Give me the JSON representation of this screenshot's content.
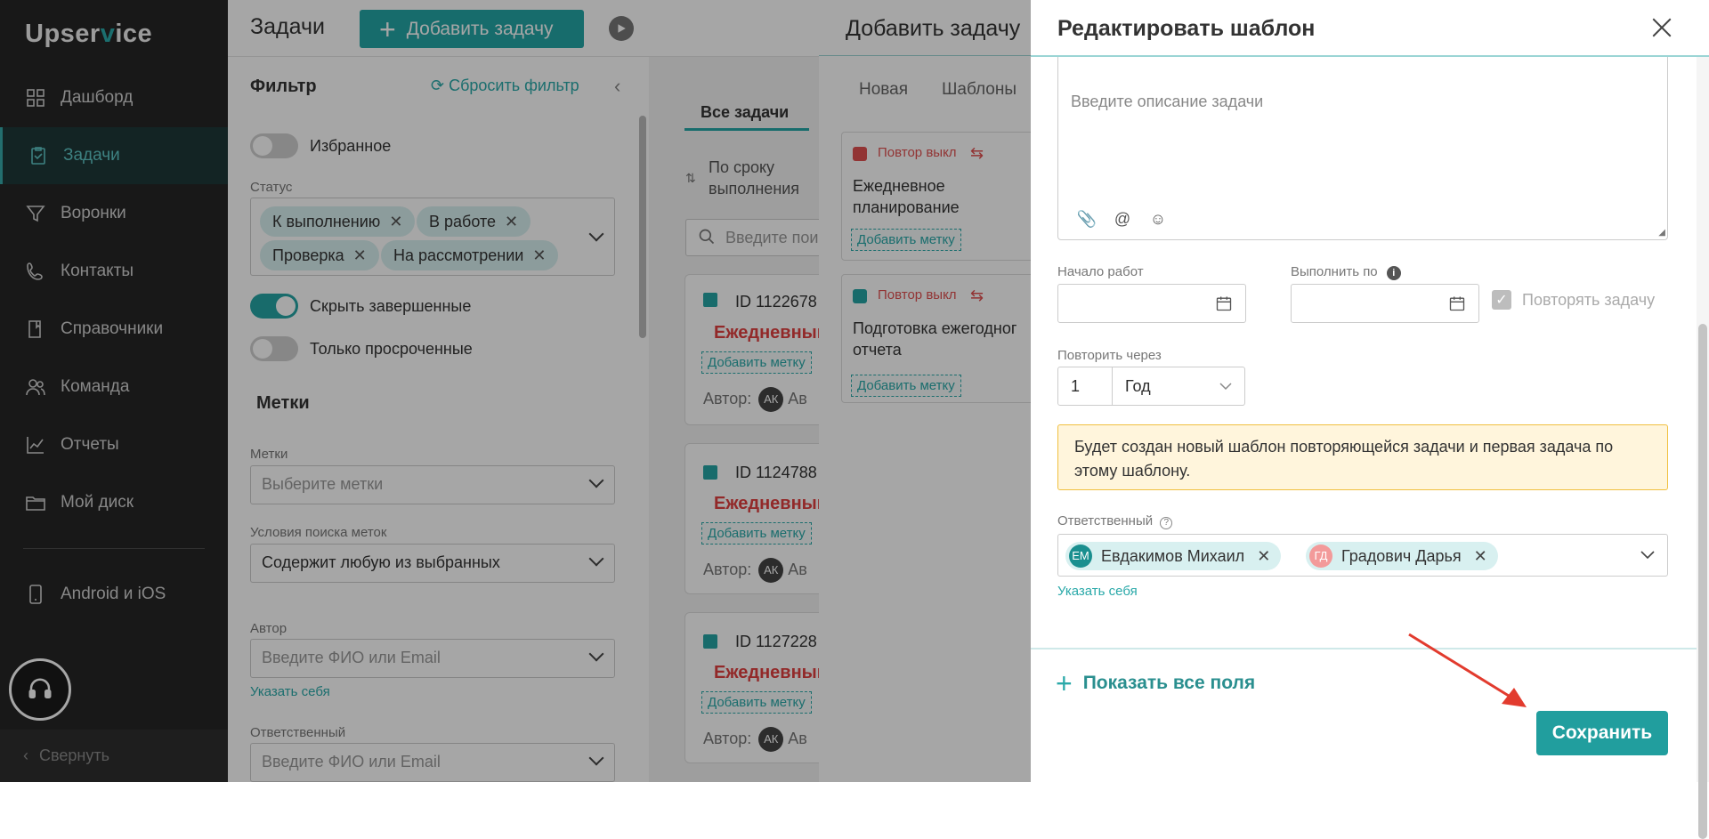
{
  "sidebar": {
    "logo_pre": "Upser",
    "logo_v": "v",
    "logo_post": "ice",
    "items": [
      {
        "label": "Дашборд",
        "icon": "dashboard-icon"
      },
      {
        "label": "Задачи",
        "icon": "tasks-icon"
      },
      {
        "label": "Воронки",
        "icon": "funnel-icon"
      },
      {
        "label": "Контакты",
        "icon": "contacts-icon"
      },
      {
        "label": "Справочники",
        "icon": "book-icon"
      },
      {
        "label": "Команда",
        "icon": "team-icon"
      },
      {
        "label": "Отчеты",
        "icon": "chart-icon"
      },
      {
        "label": "Мой диск",
        "icon": "folder-icon"
      },
      {
        "label": "Android и iOS",
        "icon": "phone-icon"
      }
    ],
    "collapse_label": "Свернуть"
  },
  "header": {
    "title": "Задачи",
    "add_button": "Добавить задачу"
  },
  "filter": {
    "title": "Фильтр",
    "reset": "Сбросить фильтр",
    "favorites": "Избранное",
    "status_label": "Статус",
    "status_chips": [
      "К выполнению",
      "В работе",
      "Проверка",
      "На рассмотрении"
    ],
    "hide_done": "Скрыть завершенные",
    "only_overdue": "Только просроченные",
    "tags_section": "Метки",
    "tags_label": "Метки",
    "tags_placeholder": "Выберите метки",
    "tag_cond_label": "Условия поиска меток",
    "tag_cond_value": "Содержит любую из выбранных",
    "author_label": "Автор",
    "author_placeholder": "Введите ФИО или Email",
    "author_self": "Указать себя",
    "resp_label": "Ответственный",
    "resp_placeholder": "Введите ФИО или Email"
  },
  "list": {
    "tab": "Все задачи",
    "sort_line1": "По сроку",
    "sort_line2": "выполнения",
    "search_placeholder": "Введите пои",
    "cards": [
      {
        "id": "ID 1122678",
        "name": "Ежедневный",
        "tag": "Добавить метку",
        "author": "Автор:",
        "initials": "АК",
        "author_rest": "Ав"
      },
      {
        "id": "ID 1124788",
        "name": "Ежедневный",
        "tag": "Добавить метку",
        "author": "Автор:",
        "initials": "АК",
        "author_rest": "Ав"
      },
      {
        "id": "ID 1127228",
        "name": "Ежедневный",
        "tag": "Добавить метку",
        "author": "Автор:",
        "initials": "АК",
        "author_rest": "Ав"
      }
    ]
  },
  "add_dialog": {
    "title": "Добавить задачу",
    "tabs": [
      "Новая",
      "Шаблоны"
    ],
    "templates": [
      {
        "repeat": "Повтор выкл",
        "name_line1": "Ежедневное",
        "name_line2": "планирование",
        "tag": "Добавить метку"
      },
      {
        "repeat": "Повтор выкл",
        "name_line1": "Подготовка ежегодног",
        "name_line2": "отчета",
        "tag": "Добавить метку"
      }
    ]
  },
  "edit_panel": {
    "title": "Редактировать шаблон",
    "desc_placeholder": "Введите описание задачи",
    "start_label": "Начало работ",
    "due_label": "Выполнить по",
    "repeat_label": "Повторять задачу",
    "repeat_every_label": "Повторить через",
    "repeat_num": "1",
    "repeat_period": "Год",
    "notice": "Будет создан новый шаблон повторяющейся задачи и первая задача по этому шаблону.",
    "resp_label": "Ответственный",
    "people": [
      {
        "initials": "ЕМ",
        "name": "Евдакимов Михаил",
        "color": "#1a8f8f"
      },
      {
        "initials": "ГД",
        "name": "Градович Дарья",
        "color": "#f39a9a"
      }
    ],
    "assign_self": "Указать себя",
    "show_all": "Показать все поля",
    "save": "Сохранить"
  }
}
